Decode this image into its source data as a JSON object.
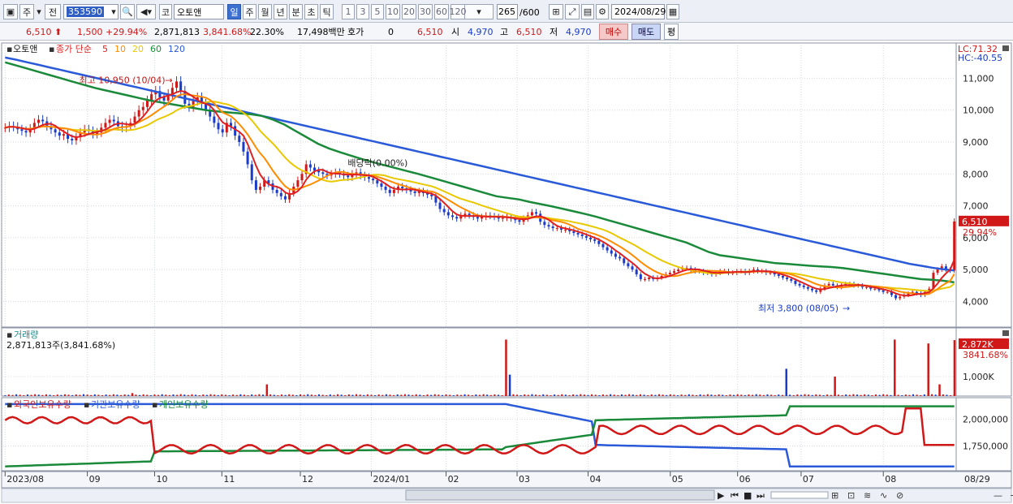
{
  "toolbar": {
    "market_labels": [
      "주",
      "전"
    ],
    "stock_code": "353590",
    "stock_type": "코",
    "stock_name": "오토앤",
    "periods": [
      {
        "label": "일",
        "selected": true
      },
      {
        "label": "주",
        "selected": false
      },
      {
        "label": "월",
        "selected": false
      },
      {
        "label": "년",
        "selected": false
      },
      {
        "label": "분",
        "selected": false
      },
      {
        "label": "초",
        "selected": false
      },
      {
        "label": "틱",
        "selected": false
      }
    ],
    "intervals": [
      "1",
      "3",
      "5",
      "10",
      "20",
      "30",
      "60",
      "120"
    ],
    "count": "265",
    "count_max": "/600",
    "date": "2024/08/29"
  },
  "infobar": {
    "price": "6,510",
    "change": "1,500",
    "change_pct": "+29.94%",
    "volume": "2,871,813",
    "volume_ratio": "3,841.68%",
    "turnover": "22.30%",
    "trade_value": "17,498백만",
    "hoga_label": "호가",
    "hoga_value": "0",
    "current": "6,510",
    "open_label": "시",
    "open": "4,970",
    "high_label": "고",
    "high": "6,510",
    "low_label": "저",
    "low": "4,970",
    "buy_label": "매수",
    "sell_label": "매도",
    "avg_label": "평"
  },
  "chart_data": {
    "type": "line",
    "title": "오토앤",
    "price_panel": {
      "legend": {
        "name": "오토앤",
        "ma_label": "종가 단순",
        "ma_periods": [
          "5",
          "10",
          "20",
          "60",
          "120"
        ],
        "ma_colors": [
          "#e02020",
          "#ff8c00",
          "#e8c800",
          "#1a8a3a",
          "#2a5ad8"
        ]
      },
      "y_ticks": [
        "11,000",
        "10,000",
        "9,000",
        "8,000",
        "7,000",
        "6,000",
        "5,000",
        "4,000"
      ],
      "ylim": [
        3400,
        11800
      ],
      "top_labels": [
        "LC:71.32",
        "HC:-40.55"
      ],
      "last_price": "6,510",
      "last_change": "29.94%",
      "annotations": {
        "high": "최고 10,950 (10/04)",
        "low": "최저 3,800 (08/05)",
        "dividend": "배당락(0.00%)"
      },
      "close": [
        9450,
        9500,
        9480,
        9400,
        9350,
        9300,
        9420,
        9600,
        9700,
        9650,
        9500,
        9400,
        9300,
        9200,
        9250,
        9100,
        9050,
        9150,
        9300,
        9400,
        9350,
        9250,
        9300,
        9450,
        9600,
        9700,
        9650,
        9500,
        9450,
        9500,
        9600,
        9800,
        10000,
        10100,
        10300,
        10500,
        10600,
        10400,
        10300,
        10500,
        10700,
        10900,
        10600,
        10200,
        10100,
        10300,
        10400,
        10200,
        10000,
        9800,
        9600,
        9400,
        9300,
        9600,
        9500,
        9200,
        9000,
        8700,
        8300,
        7800,
        7500,
        7600,
        7800,
        7700,
        7500,
        7400,
        7300,
        7200,
        7400,
        7600,
        7800,
        8000,
        8300,
        8200,
        8100,
        8050,
        8000,
        7950,
        8000,
        8050,
        8000,
        7950,
        7900,
        8000,
        8050,
        7950,
        7900,
        7850,
        7800,
        7700,
        7600,
        7500,
        7400,
        7500,
        7600,
        7550,
        7500,
        7450,
        7400,
        7450,
        7400,
        7350,
        7300,
        7100,
        6900,
        6800,
        6700,
        6650,
        6600,
        6700,
        6750,
        6700,
        6650,
        6600,
        6650,
        6700,
        6680,
        6650,
        6600,
        6620,
        6650,
        6600,
        6550,
        6500,
        6600,
        6700,
        6800,
        6750,
        6500,
        6400,
        6350,
        6300,
        6300,
        6250,
        6250,
        6200,
        6150,
        6100,
        6050,
        6000,
        5950,
        5900,
        5800,
        5700,
        5600,
        5500,
        5400,
        5350,
        5200,
        5100,
        5000,
        4850,
        4700,
        4700,
        4750,
        4700,
        4750,
        4800,
        4850,
        4900,
        4950,
        5000,
        5050,
        5050,
        5000,
        4950,
        4950,
        4900,
        4900,
        4850,
        4900,
        4950,
        4950,
        4900,
        4900,
        4950,
        4950,
        4900,
        4950,
        5000,
        4950,
        4950,
        4900,
        4900,
        4850,
        4800,
        4750,
        4700,
        4650,
        4550,
        4500,
        4450,
        4400,
        4350,
        4300,
        4400,
        4500,
        4550,
        4500,
        4450,
        4500,
        4550,
        4550,
        4500,
        4500,
        4450,
        4450,
        4400,
        4400,
        4350,
        4300,
        4300,
        4200,
        4100,
        4150,
        4200,
        4250,
        4300,
        4250,
        4200,
        4300,
        4400,
        4900,
        5000,
        5100,
        5000,
        4970,
        6510
      ],
      "ma60": [
        11500,
        11400,
        11300,
        11200,
        11100,
        11000,
        10900,
        10800,
        10700,
        10620,
        10540,
        10460,
        10380,
        10300,
        10240,
        10180,
        10120,
        10060,
        10000,
        9960,
        9930,
        9900,
        9870,
        9820,
        9700,
        9550,
        9350,
        9150,
        8950,
        8800,
        8680,
        8570,
        8460,
        8360,
        8270,
        8180,
        8090,
        8000,
        7900,
        7800,
        7700,
        7600,
        7500,
        7400,
        7300,
        7250,
        7200,
        7120,
        7050,
        6980,
        6900,
        6820,
        6740,
        6650,
        6550,
        6450,
        6350,
        6250,
        6150,
        6050,
        5950,
        5850,
        5700,
        5550,
        5450,
        5400,
        5350,
        5300,
        5250,
        5200,
        5180,
        5150,
        5120,
        5100,
        5080,
        5050,
        5000,
        4950,
        4900,
        4850,
        4800,
        4750,
        4700,
        4680,
        4650,
        4600
      ],
      "ma120": [
        11650,
        11580,
        11500,
        11420,
        11340,
        11260,
        11180,
        11100,
        11020,
        10940,
        10860,
        10780,
        10700,
        10620,
        10540,
        10460,
        10380,
        10300,
        10220,
        10140,
        10060,
        9980,
        9900,
        9820,
        9740,
        9660,
        9580,
        9500,
        9420,
        9340,
        9260,
        9180,
        9100,
        9020,
        8940,
        8860,
        8780,
        8700,
        8620,
        8540,
        8460,
        8380,
        8300,
        8220,
        8140,
        8060,
        7980,
        7900,
        7820,
        7740,
        7660,
        7580,
        7500,
        7420,
        7340,
        7260,
        7180,
        7100,
        7020,
        6940,
        6860,
        6780,
        6700,
        6620,
        6540,
        6460,
        6380,
        6300,
        6220,
        6140,
        6060,
        5980,
        5900,
        5820,
        5740,
        5660,
        5580,
        5500,
        5420,
        5340,
        5260,
        5180,
        5120,
        5060,
        5010,
        4970
      ]
    },
    "volume_panel": {
      "title": "거래량",
      "summary": "2,871,813주(3,841.68%)",
      "y_ticks": [
        "1,000K"
      ],
      "ylim": [
        0,
        3000
      ],
      "last_label": "2,872K",
      "last_ratio": "3841.68%",
      "spikes": [
        {
          "i": 34,
          "v": 150
        },
        {
          "i": 70,
          "v": 600
        },
        {
          "i": 134,
          "v": 2900
        },
        {
          "i": 135,
          "v": 1100
        },
        {
          "i": 209,
          "v": 1400
        },
        {
          "i": 222,
          "v": 1000
        },
        {
          "i": 238,
          "v": 2900
        },
        {
          "i": 247,
          "v": 2700
        },
        {
          "i": 250,
          "v": 600
        },
        {
          "i": 254,
          "v": 2872
        }
      ]
    },
    "holding_panel": {
      "legend": [
        "외국인보유수량",
        "기관보유수량",
        "개인보유수량"
      ],
      "legend_colors": [
        "#d01818",
        "#2a5ad8",
        "#1a8a3a"
      ],
      "y_ticks": [
        "2,000,000",
        "1,750,000"
      ],
      "ylim": [
        1520000,
        2200000
      ]
    },
    "x_axis": {
      "labels": [
        "2023/08",
        "09",
        "10",
        "11",
        "12",
        "2024/01",
        "02",
        "03",
        "04",
        "05",
        "06",
        "07",
        "08"
      ],
      "label_index": [
        0,
        22,
        40,
        58,
        79,
        98,
        118,
        137,
        156,
        178,
        196,
        213,
        235
      ],
      "end_label": "08/29",
      "n": 255
    }
  }
}
